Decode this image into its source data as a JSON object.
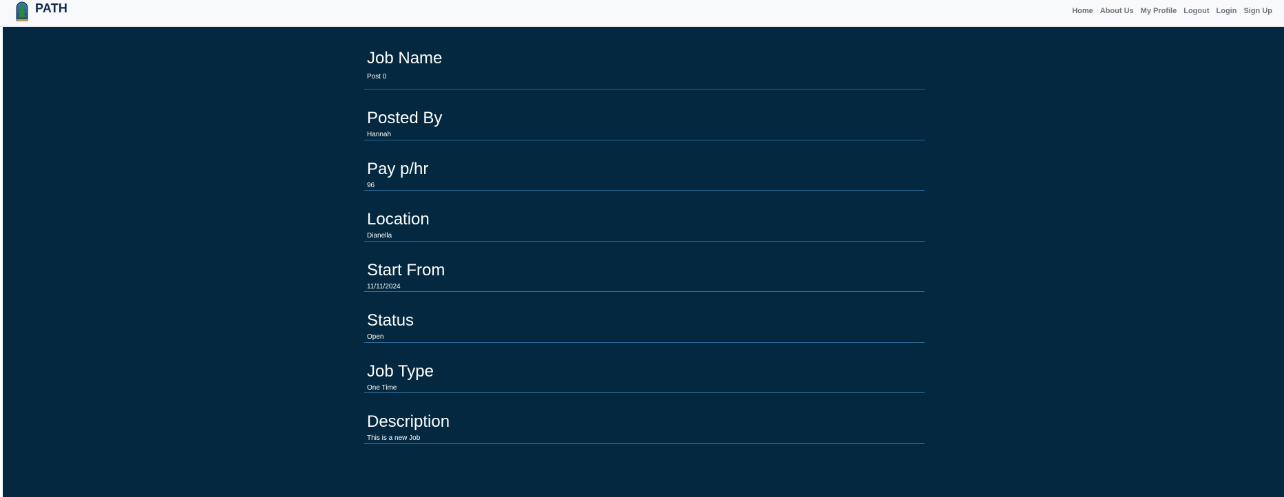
{
  "brand": {
    "name": "PATH",
    "logo_icon": "tree-logo-icon"
  },
  "nav": {
    "items": [
      {
        "label": "Home"
      },
      {
        "label": "About Us"
      },
      {
        "label": "My Profile"
      },
      {
        "label": "Logout"
      },
      {
        "label": "Login"
      },
      {
        "label": "Sign Up"
      }
    ]
  },
  "job": {
    "fields": [
      {
        "label": "Job Name",
        "value": "Post 0"
      },
      {
        "label": "Posted By",
        "value": "Hannah"
      },
      {
        "label": "Pay p/hr",
        "value": "96"
      },
      {
        "label": "Location",
        "value": "Dianella"
      },
      {
        "label": "Start From",
        "value": "11/11/2024"
      },
      {
        "label": "Status",
        "value": "Open"
      },
      {
        "label": "Job Type",
        "value": "One Time"
      },
      {
        "label": "Description",
        "value": "This is a new Job"
      }
    ]
  },
  "colors": {
    "navbar_bg": "#f8f9fa",
    "brand_text": "#0e2a4a",
    "nav_link": "#6c757d",
    "main_bg": "#03283f",
    "divider": "#2a6a9a",
    "text": "#ffffff"
  }
}
